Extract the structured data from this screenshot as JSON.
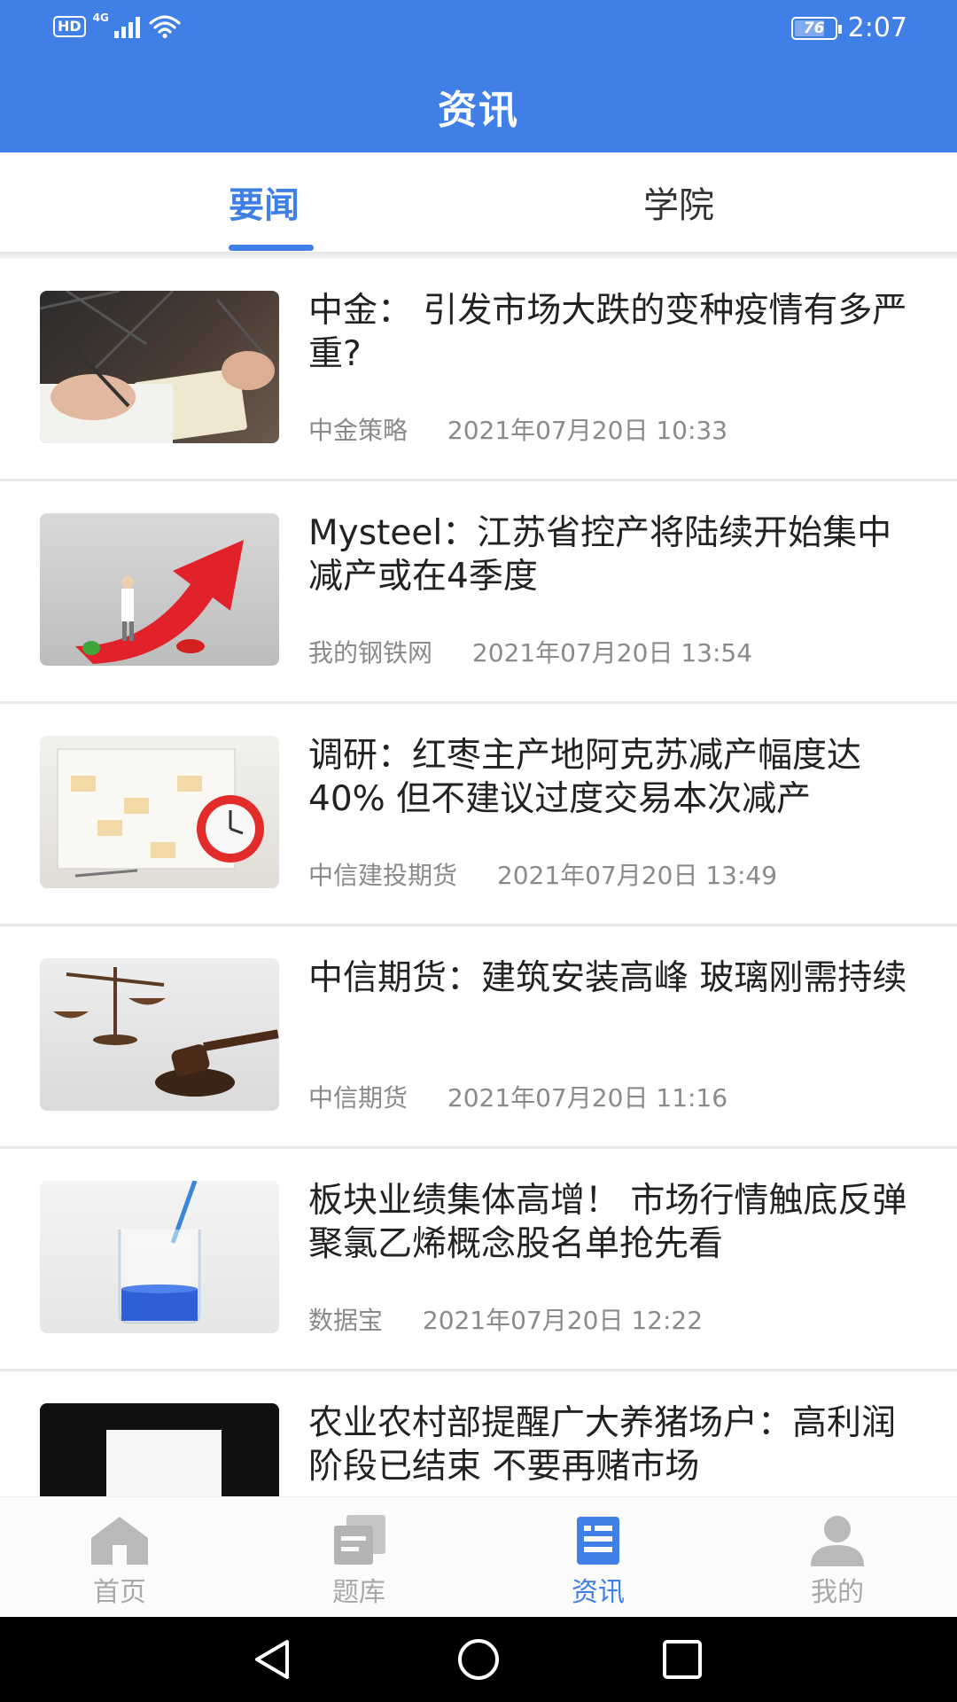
{
  "status_bar": {
    "hd": "HD",
    "network": "4G",
    "battery": "76",
    "battery_level": 0.76,
    "time": "2:07"
  },
  "header": {
    "title": "资讯"
  },
  "tabs": [
    {
      "label": "要闻",
      "active": true
    },
    {
      "label": "学院",
      "active": false
    }
  ],
  "news": [
    {
      "title": "中金： 引发市场大跌的变种疫情有多严重?",
      "source": "中金策略",
      "time": "2021年07月20日 10:33",
      "thumb": "writing-hand-image"
    },
    {
      "title": "Mysteel：江苏省控产将陆续开始集中减产或在4季度",
      "source": "我的钢铁网",
      "time": "2021年07月20日 13:54",
      "thumb": "red-arrow-image"
    },
    {
      "title": "调研：红枣主产地阿克苏减产幅度达40% 但不建议过度交易本次减产",
      "source": "中信建投期货",
      "time": "2021年07月20日 13:49",
      "thumb": "calendar-clock-image"
    },
    {
      "title": "中信期货：建筑安装高峰 玻璃刚需持续",
      "source": "中信期货",
      "time": "2021年07月20日 11:16",
      "thumb": "scales-gavel-image"
    },
    {
      "title": "板块业绩集体高增！ 市场行情触底反弹 聚氯乙烯概念股名单抢先看",
      "source": "数据宝",
      "time": "2021年07月20日 12:22",
      "thumb": "beaker-pipette-image"
    },
    {
      "title": "农业农村部提醒广大养猪场户：高利润阶段已结束 不要再赌市场",
      "source": "",
      "time": "",
      "thumb": "white-card-image"
    }
  ],
  "bottom_nav": [
    {
      "label": "首页",
      "icon": "home-icon",
      "active": false
    },
    {
      "label": "题库",
      "icon": "question-bank-icon",
      "active": false
    },
    {
      "label": "资讯",
      "icon": "news-icon",
      "active": true
    },
    {
      "label": "我的",
      "icon": "profile-icon",
      "active": false
    }
  ],
  "colors": {
    "primary": "#3f7fe6",
    "inactive": "#a8a8a8",
    "meta": "#8a8a8a"
  }
}
